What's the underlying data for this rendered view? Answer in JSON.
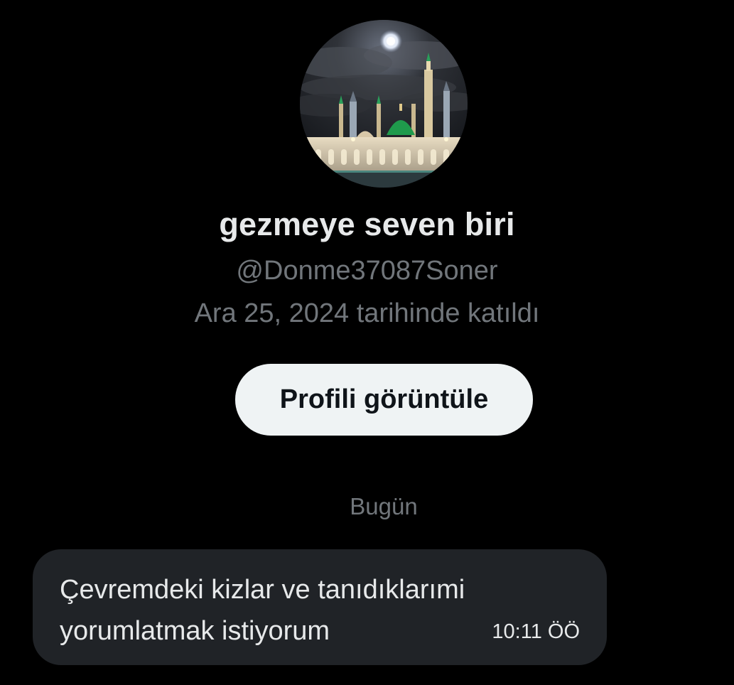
{
  "profile": {
    "display_name": "gezmeye seven biri",
    "handle": "@Donme37087Soner",
    "joined": "Ara 25, 2024 tarihinde katıldı",
    "view_profile_label": "Profili görüntüle"
  },
  "conversation": {
    "day_separator": "Bugün",
    "messages": [
      {
        "text": "Çevremdeki kizlar ve tanıdıklarımi\nyorumlatmak istiyorum",
        "time": "10:11 ÖÖ"
      }
    ]
  },
  "colors": {
    "background": "#000000",
    "primary_text": "#e7e9ea",
    "secondary_text": "#71767b",
    "button_bg": "#eff3f4",
    "bubble_bg": "#202327"
  }
}
